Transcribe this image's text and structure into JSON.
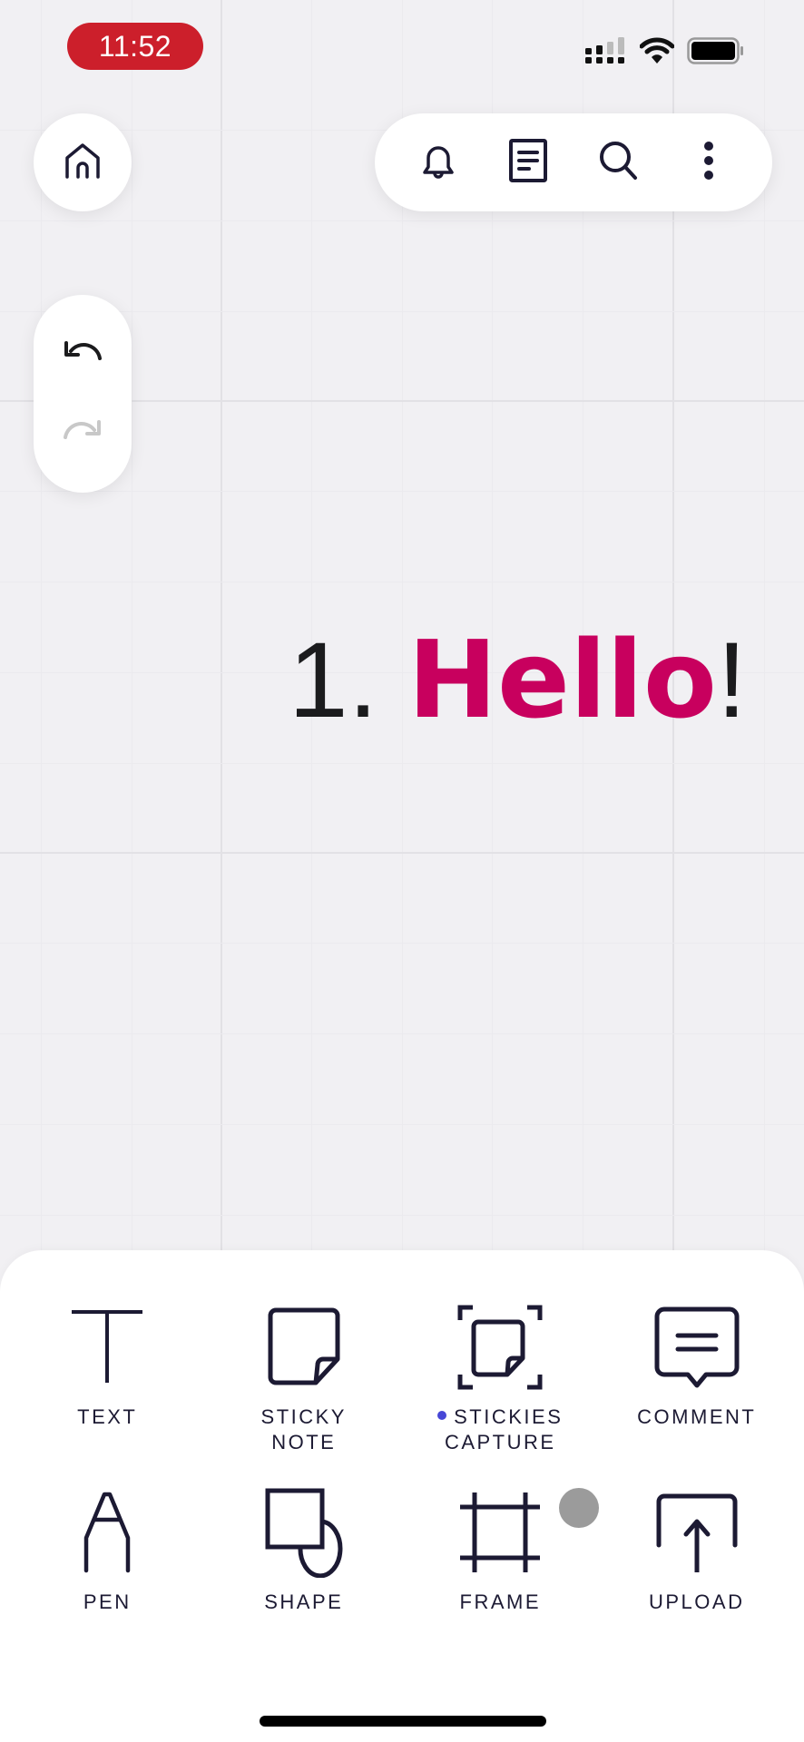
{
  "status_bar": {
    "time": "11:52",
    "time_pill_color": "#cc1f2b",
    "icons": [
      "cellular-signal-icon",
      "wifi-icon",
      "battery-icon"
    ]
  },
  "top_left": {
    "home_icon": "home-icon"
  },
  "top_toolbar": {
    "items": [
      {
        "name": "notifications",
        "icon": "bell-icon"
      },
      {
        "name": "board-info",
        "icon": "document-icon"
      },
      {
        "name": "search",
        "icon": "search-icon"
      },
      {
        "name": "more",
        "icon": "more-vertical-icon"
      }
    ]
  },
  "history": {
    "undo": {
      "icon": "undo-icon",
      "enabled": true
    },
    "redo": {
      "icon": "redo-icon",
      "enabled": false
    }
  },
  "canvas": {
    "text_number": "1. ",
    "text_hello": "Hello",
    "text_exclaim": "!",
    "hello_color": "#c8005e"
  },
  "toolbar_sheet": {
    "tools": [
      {
        "label": "TEXT",
        "icon": "text-icon"
      },
      {
        "label": "STICKY\nNOTE",
        "icon": "sticky-note-icon"
      },
      {
        "label": "STICKIES\nCAPTURE",
        "icon": "stickies-capture-icon",
        "new_badge": true
      },
      {
        "label": "COMMENT",
        "icon": "comment-icon"
      },
      {
        "label": "PEN",
        "icon": "pen-icon"
      },
      {
        "label": "SHAPE",
        "icon": "shape-icon"
      },
      {
        "label": "FRAME",
        "icon": "frame-icon"
      },
      {
        "label": "UPLOAD",
        "icon": "upload-icon"
      }
    ],
    "ink_color": "#1c1a33",
    "badge_color": "#4747d6"
  }
}
